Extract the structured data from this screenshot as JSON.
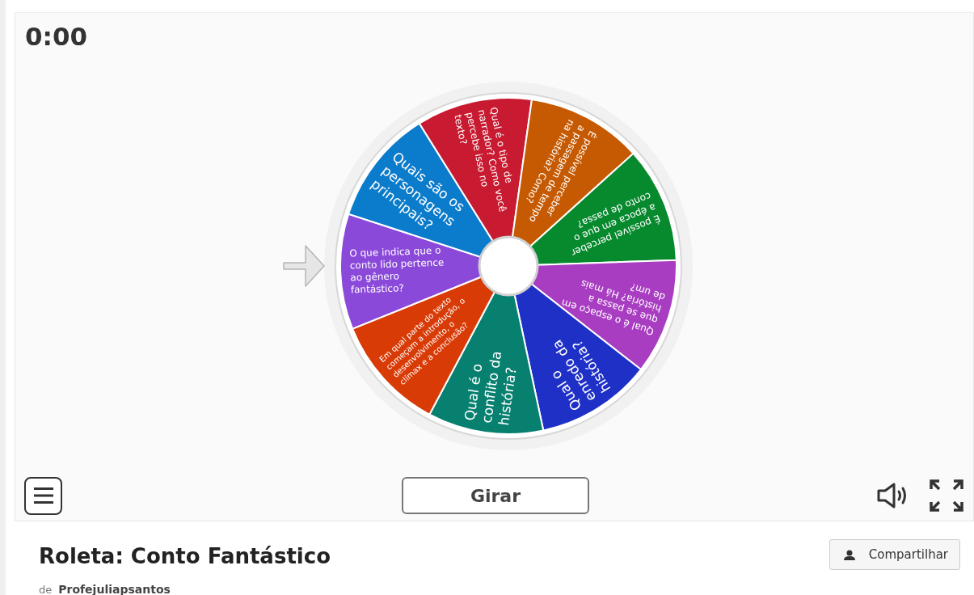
{
  "timer": "0:00",
  "wheel": {
    "segments": [
      {
        "text": "O que indica que o conto lido pertence ao gênero fantástico?",
        "color": "#8b49d9"
      },
      {
        "text": "Quais são os personagens principais?",
        "color": "#0b7bcb"
      },
      {
        "text": "Qual é o tipo de narrador? Como você percebe isso no texto?",
        "color": "#c81a30"
      },
      {
        "text": "É possível perceber a passagem de tempo na história? Como?",
        "color": "#c65a02"
      },
      {
        "text": "É possível perceber a época em que o conto de passa?",
        "color": "#07892e"
      },
      {
        "text": "Qual é o espaço em que se passa a história? Há mais de um?",
        "color": "#a93dc2"
      },
      {
        "text": "Qual o enredo da história?",
        "color": "#1f30c6"
      },
      {
        "text": "Qual é o conflito da história?",
        "color": "#078070"
      },
      {
        "text": "Em qual parte do texto começam a introdução, o desenvolvimento, o clímax e a conclusão?",
        "color": "#d93b07"
      }
    ]
  },
  "spin_button": "Girar",
  "title": "Roleta: Conto Fantástico",
  "share_button": "Compartilhar",
  "author": {
    "prefix": "de",
    "name": "Profejuliapsantos"
  }
}
